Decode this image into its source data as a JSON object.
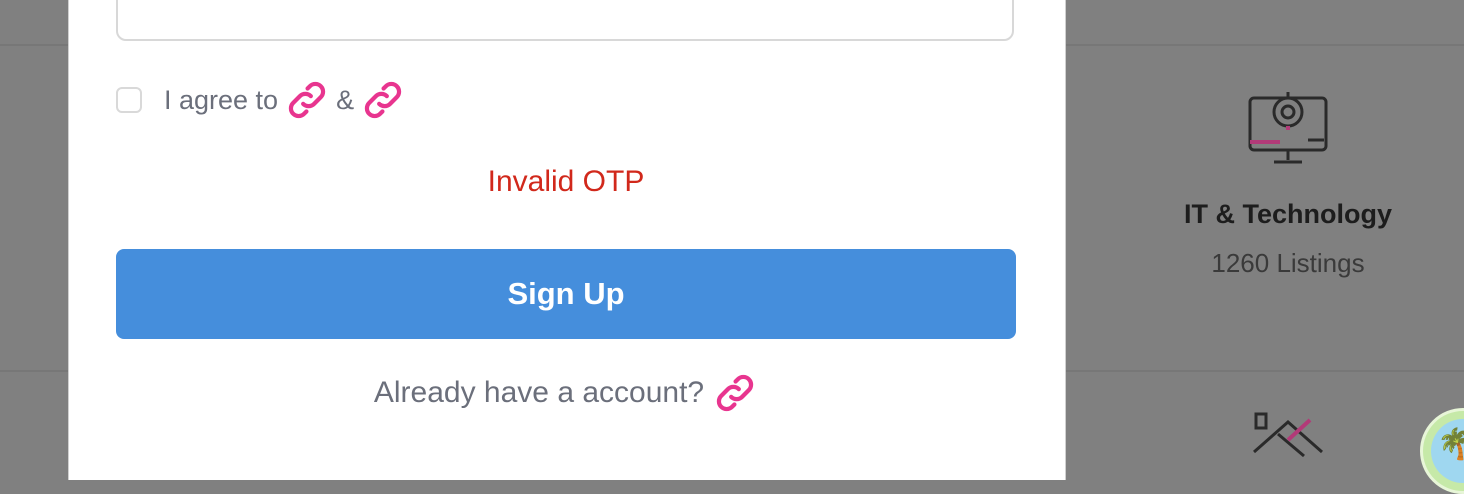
{
  "modal": {
    "agree_prefix": "I agree to",
    "agree_amp": "&",
    "error_message": "Invalid OTP",
    "signup_label": "Sign Up",
    "login_prompt": "Already have a account?"
  },
  "background": {
    "category": {
      "title": "IT & Technology",
      "count": "1260 Listings"
    }
  },
  "icons": {
    "terms_link": "link-icon",
    "privacy_link": "link-icon",
    "login_link": "link-icon",
    "category": "computer-gear-icon",
    "chat": "chat-widget-icon"
  },
  "colors": {
    "accent_link": "#e8358f",
    "primary_button": "#458edc",
    "error": "#d1281b"
  }
}
